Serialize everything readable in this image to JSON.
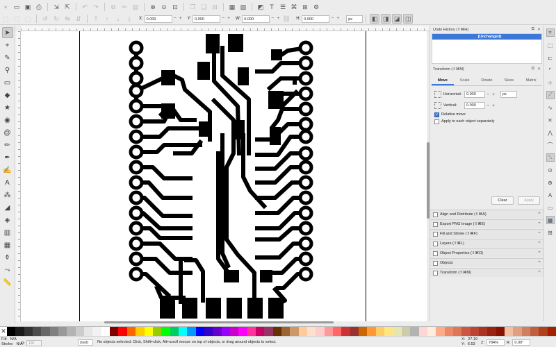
{
  "toolbar": {
    "coords": [
      {
        "label": "X:",
        "value": "0.000"
      },
      {
        "label": "Y:",
        "value": "0.000"
      },
      {
        "label": "W:",
        "value": "0.000"
      },
      {
        "label": "H:",
        "value": "0.000"
      }
    ],
    "unit": "px"
  },
  "undo_history": {
    "title": "Undo History (⇧⌘H)",
    "item": "[Unchanged]"
  },
  "transform": {
    "title": "Transform (⇧⌘M)",
    "tabs": [
      "Move",
      "Scale",
      "Rotate",
      "Skew",
      "Matrix"
    ],
    "active_tab": "Move",
    "horizontal_label": "Horizontal:",
    "horizontal_value": "0.000",
    "vertical_label": "Vertical:",
    "vertical_value": "0.000",
    "unit": "px",
    "relative_move_label": "Relative move",
    "relative_move_checked": true,
    "apply_each_label": "Apply to each object separately",
    "apply_each_checked": false,
    "clear_label": "Clear",
    "apply_label": "Apply"
  },
  "docked_panels": [
    "Align and Distribute (⇧⌘A)",
    "Export PNG Image (⇧⌘E)",
    "Fill and Stroke (⇧⌘F)",
    "Layers (⇧⌘L)",
    "Object Properties (⇧⌘O)",
    "Objects",
    "Transform (⇧⌘M)"
  ],
  "status": {
    "fill_label": "Fill:",
    "fill_value": "N/A",
    "stroke_label": "Stroke:",
    "stroke_value": "N/A",
    "opacity_label": "O:",
    "opacity_value": "100",
    "layer": "(root)",
    "message": "No objects selected. Click, Shift+click, Alt+scroll mouse on top of objects, or drag around objects to select.",
    "x_label": "X:",
    "x_value": "27.19",
    "y_label": "Y:",
    "y_value": "6.53",
    "zoom_label": "Z:",
    "zoom_value": "784%",
    "rotation_label": "R:",
    "rotation_value": "0.00°"
  },
  "palette_colors": [
    "#000000",
    "#1a1a1a",
    "#333333",
    "#4d4d4d",
    "#666666",
    "#808080",
    "#999999",
    "#b3b3b3",
    "#cccccc",
    "#e6e6e6",
    "#f2f2f2",
    "#ffffff",
    "#800000",
    "#ff0000",
    "#ff6600",
    "#ffcc00",
    "#ffff00",
    "#99cc00",
    "#00ff00",
    "#00cc66",
    "#00ffff",
    "#0099ff",
    "#0000ff",
    "#3300cc",
    "#6600cc",
    "#9900ff",
    "#cc00cc",
    "#ff00ff",
    "#ff3399",
    "#cc0066",
    "#993366",
    "#663300",
    "#996633",
    "#cc9966",
    "#ffcc99",
    "#ffe0cc",
    "#ffcccc",
    "#ff9999",
    "#ff6666",
    "#cc3333",
    "#993333",
    "#cc6600",
    "#ff9933",
    "#ffcc66",
    "#ffe680",
    "#e6e6b3",
    "#ccccaa",
    "#b3b3b3",
    "#ffd5d5",
    "#ffeedd",
    "#ffaa88",
    "#ee8866",
    "#dd7755",
    "#cc5544",
    "#bb4433",
    "#aa3322",
    "#992211",
    "#881100",
    "#f0c0a0",
    "#e0a080",
    "#d08060",
    "#c06040",
    "#b04020",
    "#a02000"
  ]
}
